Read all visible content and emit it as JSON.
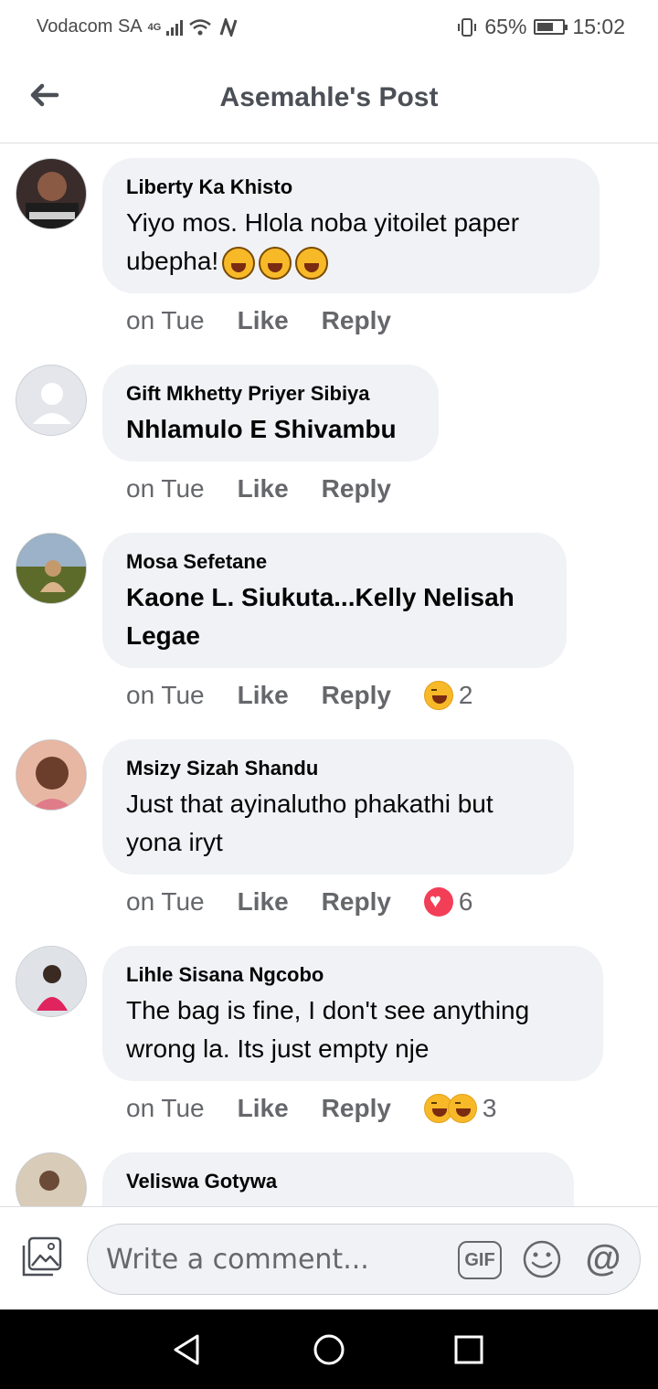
{
  "status_bar": {
    "carrier": "Vodacom SA",
    "network_type": "4G",
    "battery_percent": "65%",
    "battery_level": 0.65,
    "time": "15:02"
  },
  "header": {
    "title": "Asemahle's Post"
  },
  "comments": [
    {
      "name": "Liberty Ka Khisto",
      "text": "Yiyo mos. Hlola noba yitoilet paper ubepha!",
      "text_emojis": [
        "tears-of-joy",
        "tears-of-joy",
        "rolling-on-floor-laughing"
      ],
      "time": "on Tue",
      "like": "Like",
      "reply": "Reply",
      "reactions": [],
      "reaction_count": ""
    },
    {
      "name": "Gift Mkhetty Priyer Sibiya",
      "text": "Nhlamulo E Shivambu",
      "text_is_tag": true,
      "time": "on Tue",
      "like": "Like",
      "reply": "Reply",
      "reactions": [],
      "reaction_count": ""
    },
    {
      "name": "Mosa Sefetane",
      "text": "Kaone L. Siukuta...Kelly Nelisah Legae",
      "text_is_tag": true,
      "time": "on Tue",
      "like": "Like",
      "reply": "Reply",
      "reactions": [
        "haha"
      ],
      "reaction_count": "2"
    },
    {
      "name": "Msizy Sizah Shandu",
      "text": "Just that ayinalutho phakathi but yona iryt",
      "time": "on Tue",
      "like": "Like",
      "reply": "Reply",
      "reactions": [
        "love"
      ],
      "reaction_count": "6"
    },
    {
      "name": "Lihle Sisana Ngcobo",
      "text": "The bag is fine, I don't see anything wrong la. Its just empty nje",
      "time": "on Tue",
      "like": "Like",
      "reply": "Reply",
      "reactions": [
        "haha",
        "care"
      ],
      "reaction_count": "3"
    },
    {
      "name": "Veliswa Gotywa",
      "text": "",
      "time": "",
      "like": "",
      "reply": "",
      "reactions": [],
      "reaction_count": ""
    }
  ],
  "composer": {
    "placeholder": "Write a comment...",
    "gif_label": "GIF",
    "mention_symbol": "@"
  },
  "colors": {
    "bubble": "#f0f2f5",
    "secondary_text": "#65676b",
    "haha": "#f7b928",
    "love": "#f33e58"
  }
}
